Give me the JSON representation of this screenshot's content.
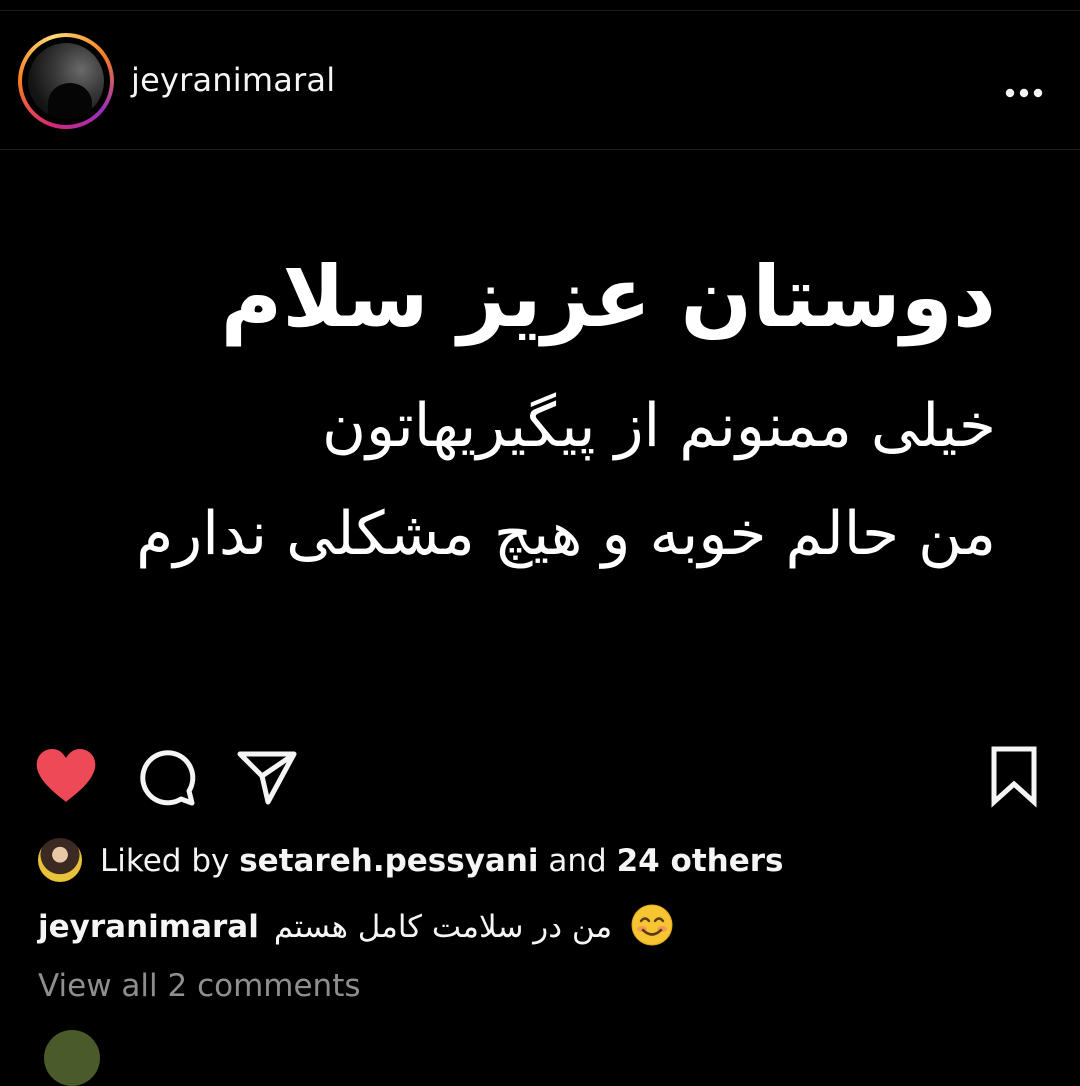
{
  "post": {
    "username": "jeyranimaral",
    "image_text": {
      "line1": "دوستان عزیز سلام",
      "line2": "خیلی ممنونم از پیگیریهاتون",
      "line3": "من حالم خوبه و هیچ مشکلی ندارم"
    }
  },
  "icons": {
    "more": "more-horizontal-icon",
    "like": "heart-icon",
    "comment": "comment-icon",
    "share": "send-icon",
    "save": "bookmark-icon"
  },
  "colors": {
    "background": "#000000",
    "text": "#f5f5f5",
    "muted": "#8e8e8e",
    "like_active": "#ed4956"
  },
  "likes": {
    "prefix": "Liked by",
    "user": "setareh.pessyani",
    "joiner": "and",
    "others": "24 others"
  },
  "caption": {
    "user": "jeyranimaral",
    "text": "من در سلامت کامل هستم"
  },
  "comments": {
    "view_all": "View all 2 comments"
  }
}
